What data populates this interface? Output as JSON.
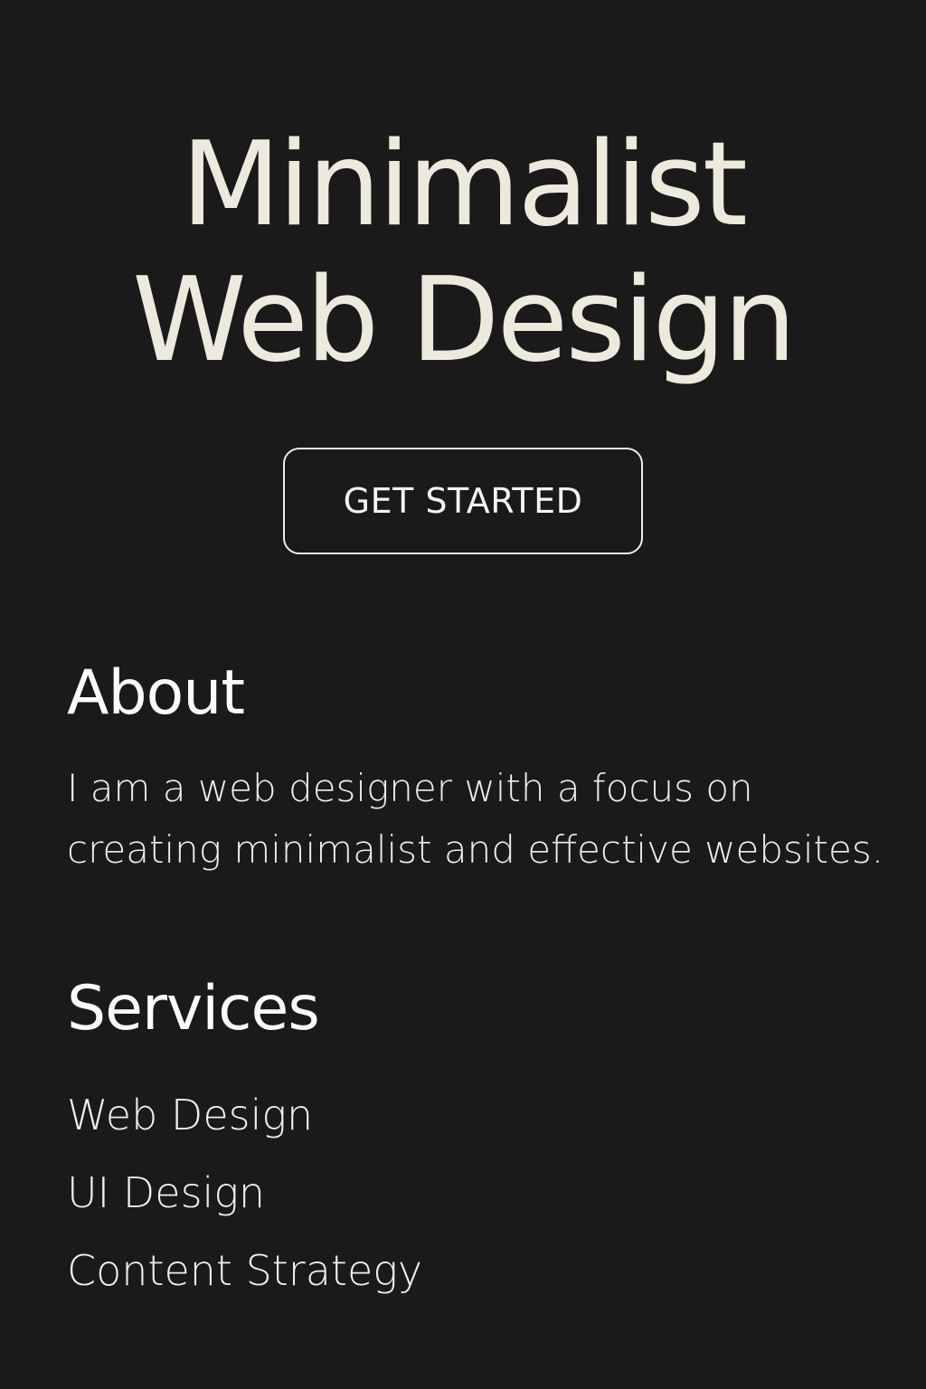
{
  "hero": {
    "title_line1": "Minimalist",
    "title_line2": "Web Design",
    "cta_label": "GET STARTED"
  },
  "about": {
    "heading": "About",
    "body": "I am a web designer with a focus on creating minimalist and effective websites."
  },
  "services": {
    "heading": "Services",
    "items": [
      "Web Design",
      "UI Design",
      "Content Strategy"
    ]
  },
  "colors": {
    "background": "#1a1a1a",
    "title": "#ede9dd",
    "text": "#f1efe7"
  }
}
